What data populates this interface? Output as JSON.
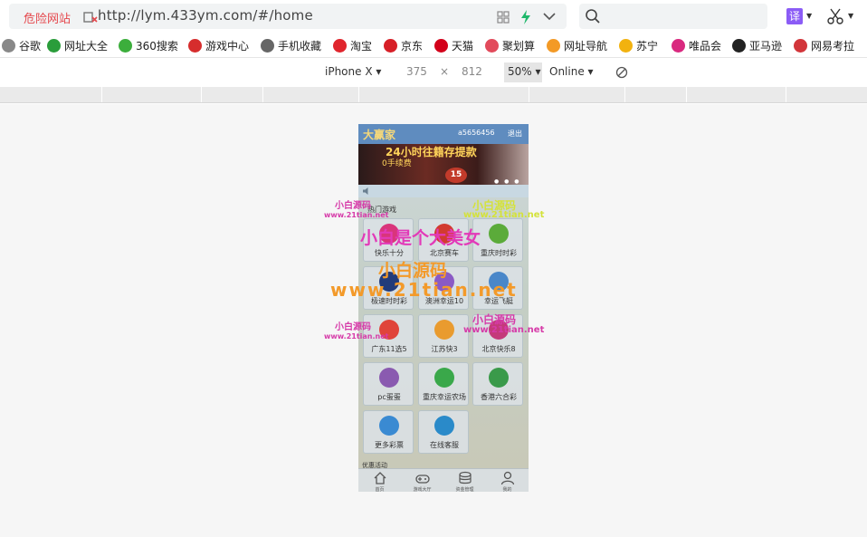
{
  "address_bar": {
    "danger_label": "危险网站",
    "url": "http://lym.433ym.com/#/home"
  },
  "toolbar": {
    "translate_label": "译"
  },
  "bookmarks": [
    {
      "label": "谷歌",
      "color": "#888888"
    },
    {
      "label": "网址大全",
      "color": "#2a9d3b"
    },
    {
      "label": "360搜索",
      "color": "#3cae3c"
    },
    {
      "label": "游戏中心",
      "color": "#d62d2d"
    },
    {
      "label": "手机收藏",
      "color": "#666666"
    },
    {
      "label": "淘宝",
      "color": "#e0252d"
    },
    {
      "label": "京东",
      "color": "#d71f27"
    },
    {
      "label": "天猫",
      "color": "#d3001a"
    },
    {
      "label": "聚划算",
      "color": "#e24a5b"
    },
    {
      "label": "网址导航",
      "color": "#f39a26"
    },
    {
      "label": "苏宁",
      "color": "#f2b20f"
    },
    {
      "label": "唯品会",
      "color": "#d9297f"
    },
    {
      "label": "亚马逊",
      "color": "#222222"
    },
    {
      "label": "网易考拉",
      "color": "#d2353a"
    }
  ],
  "device_toolbar": {
    "device": "iPhone X",
    "width": "375",
    "times": "×",
    "height": "812",
    "zoom": "50%",
    "network": "Online"
  },
  "phone": {
    "logo": "大赢家",
    "username": "a5656456",
    "logout": "退出",
    "banner_line1": "24小时往籍存提款",
    "banner_line2": "0手续费",
    "banner_ball": "15",
    "section_title": "热门游戏",
    "games": [
      {
        "label": "快乐十分",
        "color": "#d9357b"
      },
      {
        "label": "北京赛车",
        "color": "#d23b2f"
      },
      {
        "label": "重庆时时彩",
        "color": "#5bab3a"
      },
      {
        "label": "极速时时彩",
        "color": "#223b7a"
      },
      {
        "label": "澳洲幸运10",
        "color": "#8a5ac4"
      },
      {
        "label": "幸运飞艇",
        "color": "#4a87c9"
      },
      {
        "label": "广东11选5",
        "color": "#e0443a"
      },
      {
        "label": "江苏快3",
        "color": "#e99b2f"
      },
      {
        "label": "北京快乐8",
        "color": "#c43a7a"
      },
      {
        "label": "pc蛋蛋",
        "color": "#8a5ab0"
      },
      {
        "label": "重庆幸运农场",
        "color": "#3aa84a"
      },
      {
        "label": "香港六合彩",
        "color": "#3a9a4a"
      },
      {
        "label": "更多彩票",
        "color": "#3a8ad2"
      },
      {
        "label": "在线客服",
        "color": "#2a8ac9"
      }
    ],
    "tabs": [
      {
        "label": "首页"
      },
      {
        "label": "游戏大厅"
      },
      {
        "label": "资金管理"
      },
      {
        "label": "我的"
      }
    ],
    "bottom_peek": "优惠活动"
  },
  "watermarks": {
    "w1": "小白源码",
    "w2": "www.21tian.net",
    "w3": "小白是个大美女",
    "w4": "小白源码",
    "w5": "www.21tian.net",
    "w6": "小白源码",
    "w7": "www.21tian.net",
    "w8": "小白源码",
    "w9": "www.21tian.net",
    "w10": "小白源码",
    "w11": "www.21tian.net"
  }
}
